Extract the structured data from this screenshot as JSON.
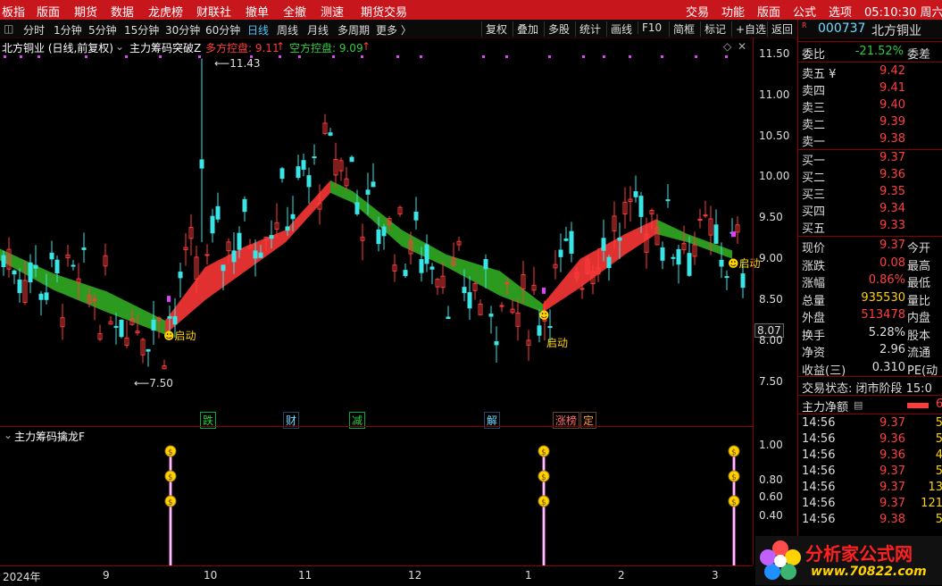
{
  "menu": [
    "板指",
    "版面",
    "期货",
    "数据",
    "龙虎榜",
    "财联社",
    "撤单",
    "全撤",
    "测速",
    "期货交易"
  ],
  "menu_right": [
    "交易",
    "功能",
    "版面",
    "公式",
    "选项"
  ],
  "clock": "05:10:30 周六",
  "periods": [
    "分时",
    "1分钟",
    "5分钟",
    "15分钟",
    "30分钟",
    "60分钟",
    "日线",
    "周线",
    "月线",
    "多周期",
    "更多 〉"
  ],
  "active_period": "日线",
  "tools": [
    "复权",
    "叠加",
    "多股",
    "统计",
    "画线",
    "F10",
    "简框",
    "标记",
    "+自选",
    "返回"
  ],
  "indicator": {
    "stock": "北方铜业 (日线,前复权)",
    "name": "主力筹码突破Z",
    "long_label": "多方控盘: 9.11",
    "short_label": "空方控盘: 9.09"
  },
  "price_axis": [
    "11.50",
    "11.00",
    "10.50",
    "10.00",
    "9.50",
    "9.00",
    "8.50",
    "8.07",
    "8.00",
    "7.50"
  ],
  "chart_labels": {
    "high": "11.43",
    "low": "7.50",
    "start": "启动"
  },
  "news_markers": [
    "跌",
    "财",
    "减",
    "解",
    "涨榜",
    "定"
  ],
  "sub_indicator": "主力筹码擒龙F",
  "sub_axis": [
    "1.00",
    "0.80",
    "0.60",
    "0.40"
  ],
  "time_axis": [
    "2024年",
    "9",
    "10",
    "11",
    "12",
    "1",
    "2",
    "3"
  ],
  "quote": {
    "code": "000737",
    "name": "北方铜业",
    "weibi_label": "委比",
    "weibi": "-21.52%",
    "weicha_label": "委差",
    "asks": [
      {
        "label": "卖五 ¥",
        "price": "9.42"
      },
      {
        "label": "卖四",
        "price": "9.41"
      },
      {
        "label": "卖三",
        "price": "9.40"
      },
      {
        "label": "卖二",
        "price": "9.39"
      },
      {
        "label": "卖一",
        "price": "9.38"
      }
    ],
    "bids": [
      {
        "label": "买一",
        "price": "9.37"
      },
      {
        "label": "买二",
        "price": "9.36"
      },
      {
        "label": "买三",
        "price": "9.35"
      },
      {
        "label": "买四",
        "price": "9.34"
      },
      {
        "label": "买五",
        "price": "9.33"
      }
    ],
    "stats": [
      {
        "label": "现价",
        "value": "9.37",
        "ext": "今开",
        "color": "#ff4040"
      },
      {
        "label": "涨跌",
        "value": "0.08",
        "ext": "最高",
        "color": "#ff4040"
      },
      {
        "label": "涨幅",
        "value": "0.86%",
        "ext": "最低",
        "color": "#ff4040"
      },
      {
        "label": "总量",
        "value": "935530",
        "ext": "量比",
        "color": "#ffd200"
      },
      {
        "label": "外盘",
        "value": "513478",
        "ext": "内盘",
        "color": "#ff4040"
      },
      {
        "label": "换手",
        "value": "5.28%",
        "ext": "股本",
        "color": "#ddd"
      },
      {
        "label": "净资",
        "value": "2.96",
        "ext": "流通",
        "color": "#ddd"
      },
      {
        "label": "收益(三)",
        "value": "0.310",
        "ext": "PE(动",
        "color": "#ddd"
      }
    ],
    "status": "交易状态: 闭市阶段 15:0",
    "main_net": "主力净额",
    "trades": [
      {
        "t": "14:56",
        "p": "9.37",
        "v": "5"
      },
      {
        "t": "14:56",
        "p": "9.36",
        "v": "5"
      },
      {
        "t": "14:56",
        "p": "9.36",
        "v": "4"
      },
      {
        "t": "14:56",
        "p": "9.37",
        "v": "5"
      },
      {
        "t": "14:56",
        "p": "9.37",
        "v": "13"
      },
      {
        "t": "14:56",
        "p": "9.37",
        "v": "121"
      },
      {
        "t": "14:56",
        "p": "9.38",
        "v": "5"
      }
    ]
  },
  "watermark": {
    "title": "分析家公式网",
    "url": "www.70822.com"
  },
  "colors": {
    "up": "#ff3b3b",
    "down": "#39e5e5",
    "band_up": "#e03030",
    "band_down": "#2c9a1e",
    "accent": "#c8161d"
  }
}
